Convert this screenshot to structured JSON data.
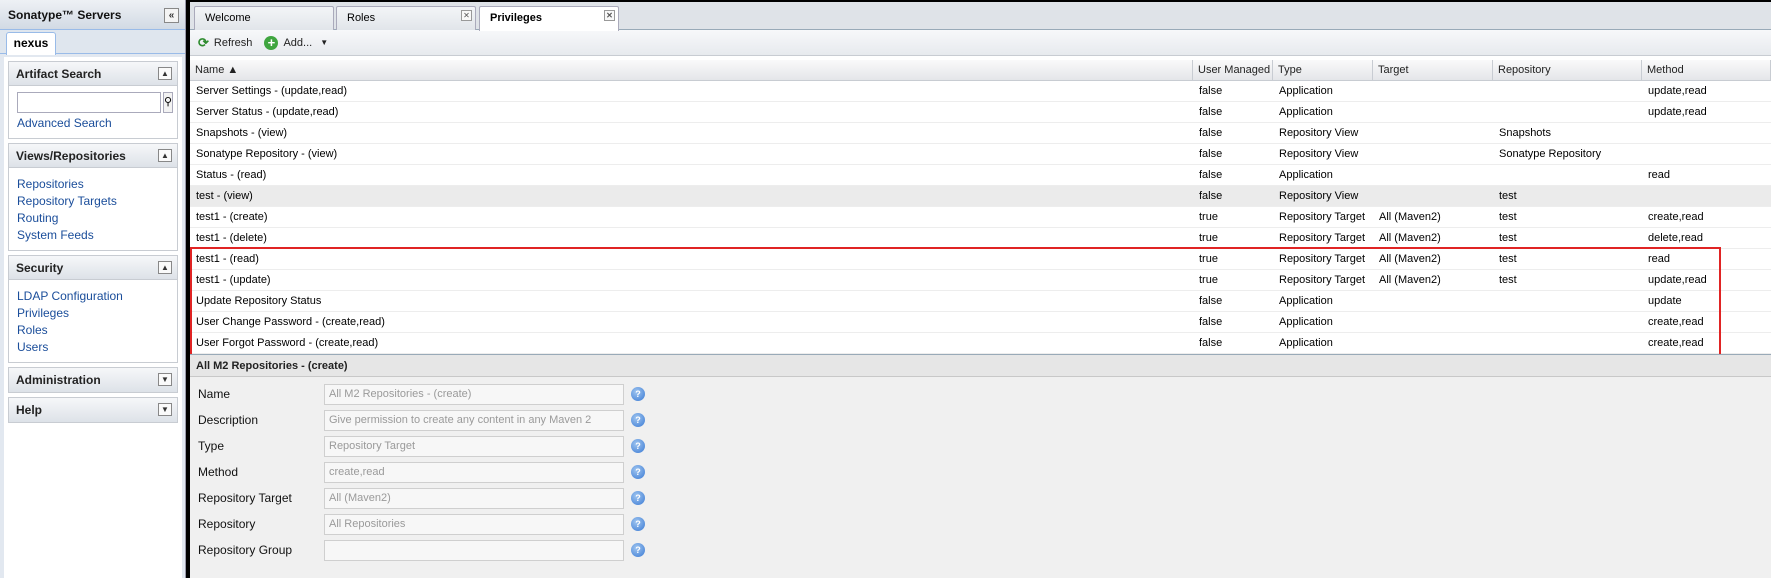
{
  "left": {
    "title": "Sonatype™ Servers",
    "collapse_icon": "«",
    "server_tab": "nexus",
    "sections": {
      "artifact_search": {
        "title": "Artifact Search",
        "toggle": "▲",
        "search_placeholder": "",
        "search_icon": "⚲",
        "link": "Advanced Search"
      },
      "views": {
        "title": "Views/Repositories",
        "toggle": "▲",
        "links": [
          "Repositories",
          "Repository Targets",
          "Routing",
          "System Feeds"
        ]
      },
      "security": {
        "title": "Security",
        "toggle": "▲",
        "links": [
          "LDAP Configuration",
          "Privileges",
          "Roles",
          "Users"
        ]
      },
      "administration": {
        "title": "Administration",
        "toggle": "▼"
      },
      "help": {
        "title": "Help",
        "toggle": "▼"
      }
    }
  },
  "tabs": [
    {
      "label": "Welcome",
      "closable": false,
      "active": false
    },
    {
      "label": "Roles",
      "closable": true,
      "active": false
    },
    {
      "label": "Privileges",
      "closable": true,
      "active": true
    }
  ],
  "toolbar": {
    "refresh": "Refresh",
    "add": "Add...",
    "dropdown_icon": "▼"
  },
  "grid": {
    "columns": [
      "Name ▲",
      "User Managed",
      "Type",
      "Target",
      "Repository",
      "Method"
    ],
    "rows": [
      [
        "Server Settings - (update,read)",
        "false",
        "Application",
        "",
        "",
        "update,read"
      ],
      [
        "Server Status - (update,read)",
        "false",
        "Application",
        "",
        "",
        "update,read"
      ],
      [
        "Snapshots - (view)",
        "false",
        "Repository View",
        "",
        "Snapshots",
        ""
      ],
      [
        "Sonatype Repository - (view)",
        "false",
        "Repository View",
        "",
        "Sonatype Repository",
        ""
      ],
      [
        "Status - (read)",
        "false",
        "Application",
        "",
        "",
        "read"
      ],
      [
        "test - (view)",
        "false",
        "Repository View",
        "",
        "test",
        ""
      ],
      [
        "test1 - (create)",
        "true",
        "Repository Target",
        "All (Maven2)",
        "test",
        "create,read"
      ],
      [
        "test1 - (delete)",
        "true",
        "Repository Target",
        "All (Maven2)",
        "test",
        "delete,read"
      ],
      [
        "test1 - (read)",
        "true",
        "Repository Target",
        "All (Maven2)",
        "test",
        "read"
      ],
      [
        "test1 - (update)",
        "true",
        "Repository Target",
        "All (Maven2)",
        "test",
        "update,read"
      ],
      [
        "Update Repository Status",
        "false",
        "Application",
        "",
        "",
        "update"
      ],
      [
        "User Change Password - (create,read)",
        "false",
        "Application",
        "",
        "",
        "create,read"
      ],
      [
        "User Forgot Password - (create,read)",
        "false",
        "Application",
        "",
        "",
        "create,read"
      ]
    ],
    "selected_row": 5
  },
  "detail": {
    "title": "All M2 Repositories - (create)",
    "fields": [
      {
        "label": "Name",
        "value": "All M2 Repositories - (create)"
      },
      {
        "label": "Description",
        "value": "Give permission to create any content in any Maven 2"
      },
      {
        "label": "Type",
        "value": "Repository Target"
      },
      {
        "label": "Method",
        "value": "create,read"
      },
      {
        "label": "Repository Target",
        "value": "All (Maven2)"
      },
      {
        "label": "Repository",
        "value": "All Repositories"
      },
      {
        "label": "Repository Group",
        "value": ""
      }
    ],
    "help_icon": "?"
  },
  "colors": {
    "highlight_border": "#e02424",
    "link": "#1a4d9a"
  }
}
